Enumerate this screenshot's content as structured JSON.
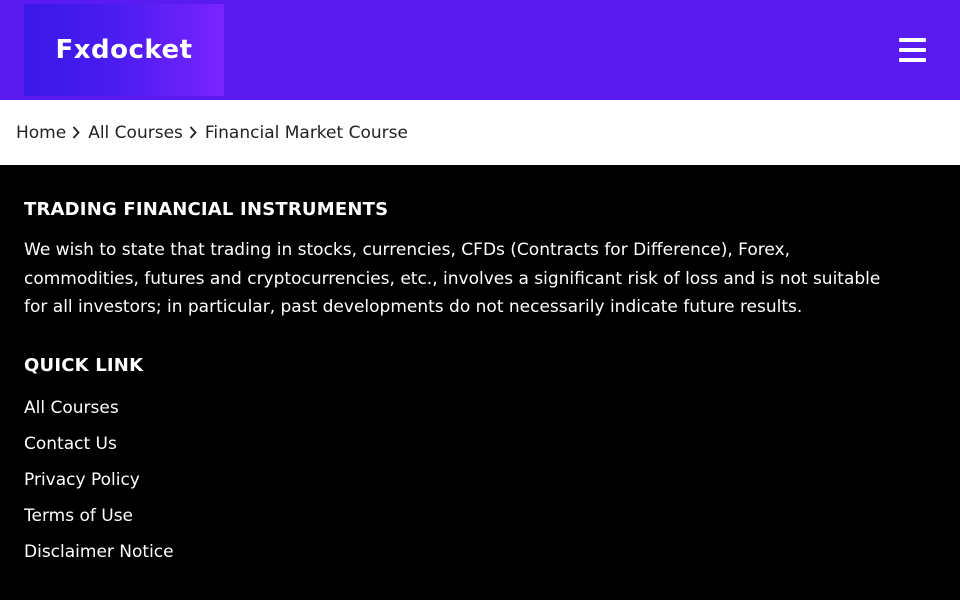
{
  "header": {
    "logo_text": "Fxdocket",
    "menu_icon": "hamburger-menu-icon",
    "background_color": "#5a1bf0"
  },
  "breadcrumb": {
    "items": [
      "Home",
      "All Courses"
    ],
    "current": "Financial Market Course",
    "separator_icon": "chevron-right-icon"
  },
  "trading_section": {
    "title": "TRADING FINANCIAL INSTRUMENTS",
    "lines": [
      "We wish to state that trading in stocks, currencies, CFDs (Contracts for Difference), Forex,",
      "commodities, futures and cryptocurrencies, etc., involves a significant risk of loss and is not suitable",
      "for all investors; in particular, past developments do not necessarily indicate future results."
    ]
  },
  "quick_link": {
    "title": "QUICK LINK",
    "links": [
      "All Courses",
      "Contact Us",
      "Privacy Policy",
      "Terms of Use",
      "Disclaimer Notice"
    ]
  }
}
